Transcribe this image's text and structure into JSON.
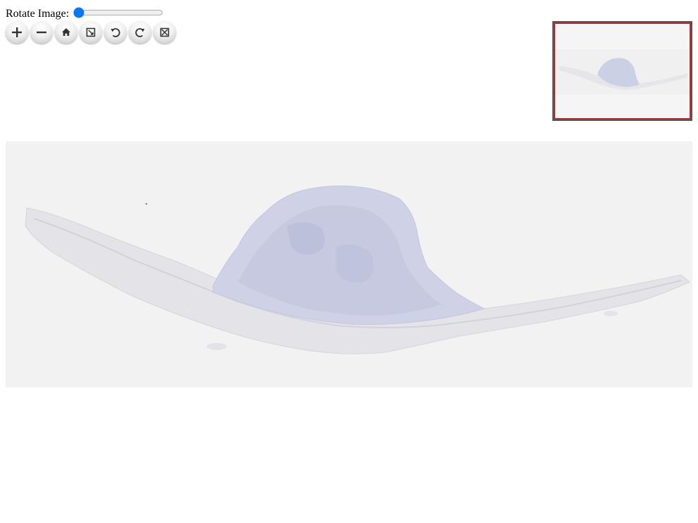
{
  "rotate": {
    "label": "Rotate Image:",
    "value": 0
  },
  "toolbar": {
    "buttons": [
      {
        "name": "zoom-in",
        "icon": "plus-icon"
      },
      {
        "name": "zoom-out",
        "icon": "minus-icon"
      },
      {
        "name": "home",
        "icon": "home-icon"
      },
      {
        "name": "full-page",
        "icon": "fullscreen-icon"
      },
      {
        "name": "rotate-left",
        "icon": "rotate-left-icon"
      },
      {
        "name": "rotate-right",
        "icon": "rotate-right-icon"
      },
      {
        "name": "flip",
        "icon": "flip-icon"
      }
    ]
  },
  "colors": {
    "tissue": "#c9cce2",
    "tissue_dark": "#b8bcd8",
    "background": "#f2f2f2",
    "navigator_border": "#b03030"
  }
}
